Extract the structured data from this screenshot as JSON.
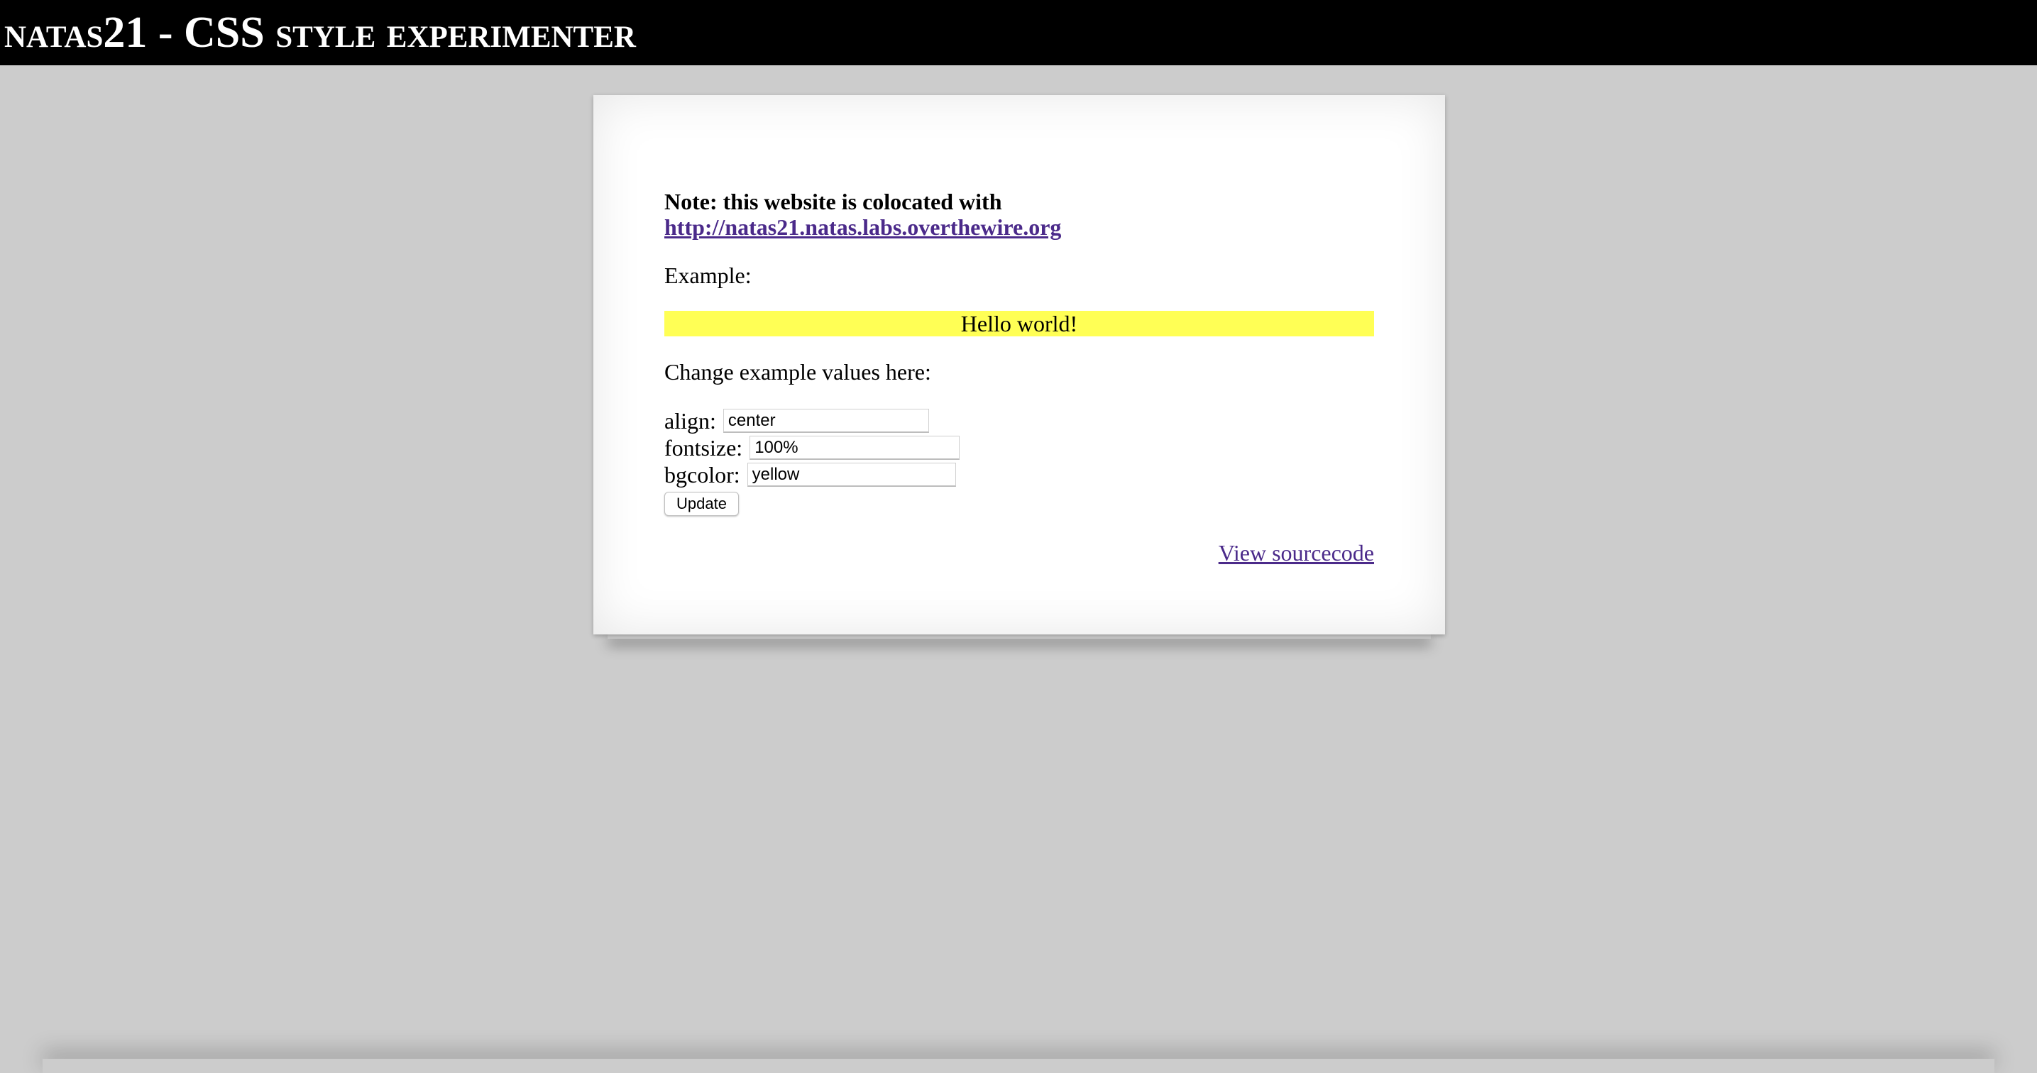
{
  "header": {
    "title": "natas21 - CSS style experimenter"
  },
  "content": {
    "note_text": "Note: this website is colocated with",
    "note_link": "http://natas21.natas.labs.overthewire.org",
    "example_label": "Example:",
    "example_text": "Hello world!",
    "example_style": {
      "align": "center",
      "fontsize": "100%",
      "bgcolor": "#ffff55"
    },
    "change_label": "Change example values here:",
    "form": {
      "fields": [
        {
          "label": "align:",
          "value": "center"
        },
        {
          "label": "fontsize:",
          "value": "100%"
        },
        {
          "label": "bgcolor:",
          "value": "yellow"
        }
      ],
      "submit_label": "Update"
    },
    "source_link": "View sourcecode"
  },
  "colors": {
    "page_bg": "#cccccc",
    "header_bg": "#000000",
    "link": "#4b2a8a",
    "example_bg": "#ffff55"
  }
}
